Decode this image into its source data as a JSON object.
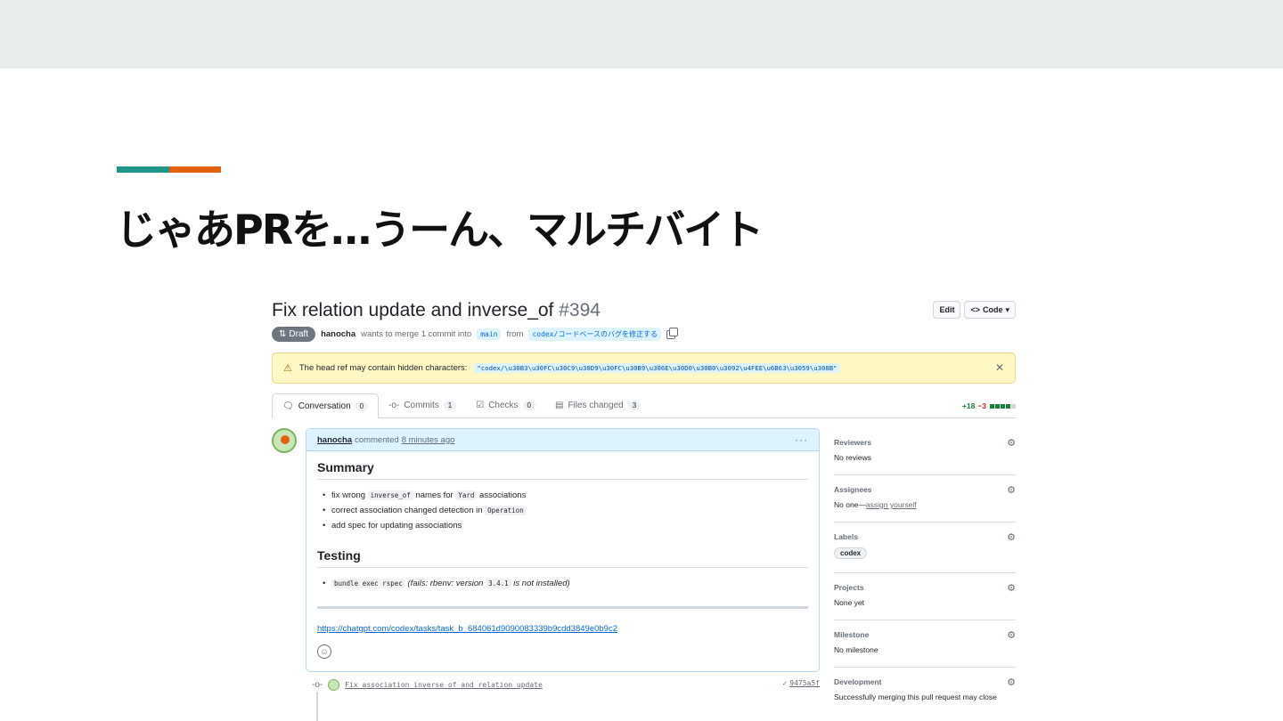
{
  "slide": {
    "title": "じゃあPRを…うーん、マルチバイト",
    "accent_colors": [
      "#21968b",
      "#e2610f"
    ]
  },
  "pr": {
    "title": "Fix relation update and inverse_of",
    "number": "#394",
    "buttons": {
      "edit": "Edit",
      "code": "Code"
    },
    "status": "Draft",
    "author": "hanocha",
    "merge_text": "wants to merge 1 commit into",
    "base_branch": "main",
    "from_text": "from",
    "head_branch": "codex/コードベースのバグを修正する",
    "warning": {
      "text": "The head ref may contain hidden characters:",
      "value": "\"codex/\\u30B3\\u30FC\\u30C9\\u30D9\\u30FC\\u30B9\\u306E\\u30D0\\u30B0\\u3092\\u4FEE\\u6B63\\u3059\\u308B\""
    },
    "tabs": [
      {
        "label": "Conversation",
        "count": "0",
        "icon": "conversation-icon"
      },
      {
        "label": "Commits",
        "count": "1",
        "icon": "commit-icon"
      },
      {
        "label": "Checks",
        "count": "0",
        "icon": "checks-icon"
      },
      {
        "label": "Files changed",
        "count": "3",
        "icon": "file-diff-icon"
      }
    ],
    "diffstat": {
      "additions": "+18",
      "deletions": "−3"
    }
  },
  "comment": {
    "author": "hanocha",
    "action": "commented",
    "time": "8 minutes ago",
    "summary_heading": "Summary",
    "summary_items": [
      {
        "pre": "fix wrong",
        "code": "inverse_of",
        "mid": "names for",
        "code2": "Yard",
        "post": "associations"
      },
      {
        "pre": "correct association changed detection in",
        "code": "Operation"
      },
      {
        "pre": "add spec for updating associations"
      }
    ],
    "testing_heading": "Testing",
    "testing_code": "bundle exec rspec",
    "testing_note_pre": "(fails: rbenv: version",
    "testing_version": "3.4.1",
    "testing_note_post": "is not installed)",
    "link": "https://chatgpt.com/codex/tasks/task_b_684061d9090083339b9cdd3849e0b9c2"
  },
  "commit": {
    "message": "Fix association inverse_of and relation update",
    "sha": "9475a5f"
  },
  "sidebar": {
    "reviewers": {
      "title": "Reviewers",
      "value": "No reviews"
    },
    "assignees": {
      "title": "Assignees",
      "value": "No one—",
      "link": "assign yourself"
    },
    "labels": {
      "title": "Labels",
      "value": "codex"
    },
    "projects": {
      "title": "Projects",
      "value": "None yet"
    },
    "milestone": {
      "title": "Milestone",
      "value": "No milestone"
    },
    "development": {
      "title": "Development",
      "value": "Successfully merging this pull request may close"
    }
  }
}
